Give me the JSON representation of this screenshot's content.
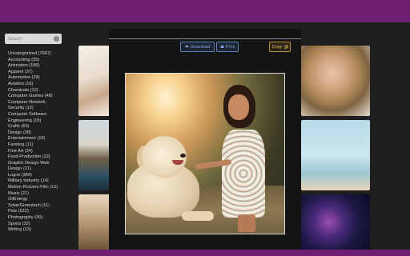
{
  "search": {
    "placeholder": "Search"
  },
  "categories": [
    "Uncategorized (7667)",
    "Accounting (35)",
    "Animation (186)",
    "Apparel (37)",
    "Automotive (29)",
    "Aviation (16)",
    "Chemicals (12)",
    "Computer Games (48)",
    "Computer Network",
    "Security (12)",
    "Computer Software",
    "Engineering (16)",
    "Crafts (65)",
    "Design (28)",
    "Entertainment (16)",
    "Farming (11)",
    "Fine Art (24)",
    "Food Production (12)",
    "Graphic Design Web",
    "Design (21)",
    "Logos (384)",
    "Military Industry (14)",
    "Motion Pictures Film (12)",
    "Music (21)",
    "OilEnergy",
    "Solar/Greentech (11)",
    "Pets (522)",
    "Photography (30)",
    "Sports (32)",
    "Writing (13)"
  ],
  "modal": {
    "download_label": "Download",
    "print_label": "Print",
    "copy_label": "Copy"
  },
  "colors": {
    "topbar": "#6e2170",
    "button_blue": "#7fa7e8",
    "button_gold": "#e8c060"
  }
}
